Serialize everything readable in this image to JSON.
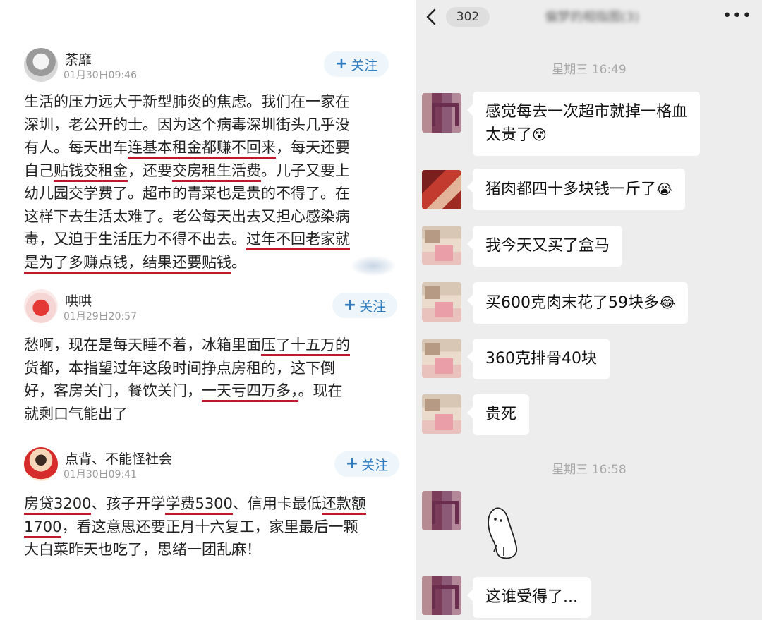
{
  "left_panel": {
    "posts": [
      {
        "username": "荼靡",
        "time": "01月30日09:46",
        "follow_label": "关注",
        "lines": [
          [
            {
              "t": "生活的压力远大于新型肺炎的焦虑。我们在一家在",
              "u": false
            }
          ],
          [
            {
              "t": "深圳，老公开的士。因为这个病毒深圳街头几乎没",
              "u": false
            }
          ],
          [
            {
              "t": "有人。每天出车",
              "u": false
            },
            {
              "t": "连基本租金都赚不回来",
              "u": true
            },
            {
              "t": "，每天还要",
              "u": false
            }
          ],
          [
            {
              "t": "自己",
              "u": false
            },
            {
              "t": "贴钱交租金",
              "u": true
            },
            {
              "t": "，还要",
              "u": false
            },
            {
              "t": "交房租生活费",
              "u": true
            },
            {
              "t": "。儿子又要上",
              "u": false
            }
          ],
          [
            {
              "t": "幼儿园交学费了。超市的青菜也是贵的不得了。在",
              "u": false
            }
          ],
          [
            {
              "t": "这样下去生活太难了。老公每天出去又担心感染病",
              "u": false
            }
          ],
          [
            {
              "t": "毒，又迫于生活压力不得不出去。",
              "u": false
            },
            {
              "t": "过年不回老家就",
              "u": true
            }
          ],
          [
            {
              "t": "是为了多赚点钱，结果还要贴钱",
              "u": true
            },
            {
              "t": "。",
              "u": false
            }
          ]
        ]
      },
      {
        "username": "哄哄",
        "time": "01月29日20:57",
        "follow_label": "关注",
        "lines": [
          [
            {
              "t": "愁啊，现在是每天睡不着，冰箱里面",
              "u": false
            },
            {
              "t": "压了十五万的",
              "u": true
            }
          ],
          [
            {
              "t": "货都，本指望过年这段时间挣点房租的，这下倒",
              "u": false
            }
          ],
          [
            {
              "t": "好，客房关门，餐饮关门，",
              "u": false
            },
            {
              "t": "一天亏四万多，",
              "u": true
            },
            {
              "t": "。现在",
              "u": false
            }
          ],
          [
            {
              "t": "就剩口气能出了",
              "u": false
            }
          ]
        ]
      },
      {
        "username": "点背、不能怪社会",
        "time": "01月30日09:41",
        "follow_label": "关注",
        "lines": [
          [
            {
              "t": "房贷3200",
              "u": true
            },
            {
              "t": "、孩子开学",
              "u": false
            },
            {
              "t": "学费5300",
              "u": true
            },
            {
              "t": "、信用卡最低",
              "u": false
            },
            {
              "t": "还款额",
              "u": true
            }
          ],
          [
            {
              "t": "1700",
              "u": true
            },
            {
              "t": "，看这意思还要正月十六复工，家里最后一颗",
              "u": false
            }
          ],
          [
            {
              "t": "大白菜昨天也吃了，思绪一团乱麻！",
              "u": false
            }
          ]
        ]
      }
    ]
  },
  "right_panel": {
    "unread_count": "302",
    "chat_title": "偏梦的相指图(3)",
    "separators": [
      "星期三 16:49",
      "星期三 16:58"
    ],
    "messages": [
      {
        "lines": [
          "感觉每去一次超市就掉一格血",
          "太贵了"
        ],
        "emoji": "😵"
      },
      {
        "lines": [
          "猪肉都四十多块钱一斤了"
        ],
        "emoji": "😭"
      },
      {
        "lines": [
          "我今天又买了盒马"
        ],
        "emoji": ""
      },
      {
        "lines": [
          "买600克肉末花了59块多"
        ],
        "emoji": "😂"
      },
      {
        "lines": [
          "360克排骨40块"
        ],
        "emoji": ""
      },
      {
        "lines": [
          "贵死"
        ],
        "emoji": ""
      },
      {
        "lines": [],
        "emoji": ""
      },
      {
        "lines": [
          "这谁受得了..."
        ],
        "emoji": ""
      }
    ]
  },
  "colors": {
    "underline": "#c0192b",
    "follow_text": "#2f7bbd",
    "follow_bg": "#eef6fb",
    "chat_bg": "#ededed"
  },
  "icons": [
    "back-arrow-icon",
    "more-icon",
    "plus-icon"
  ]
}
